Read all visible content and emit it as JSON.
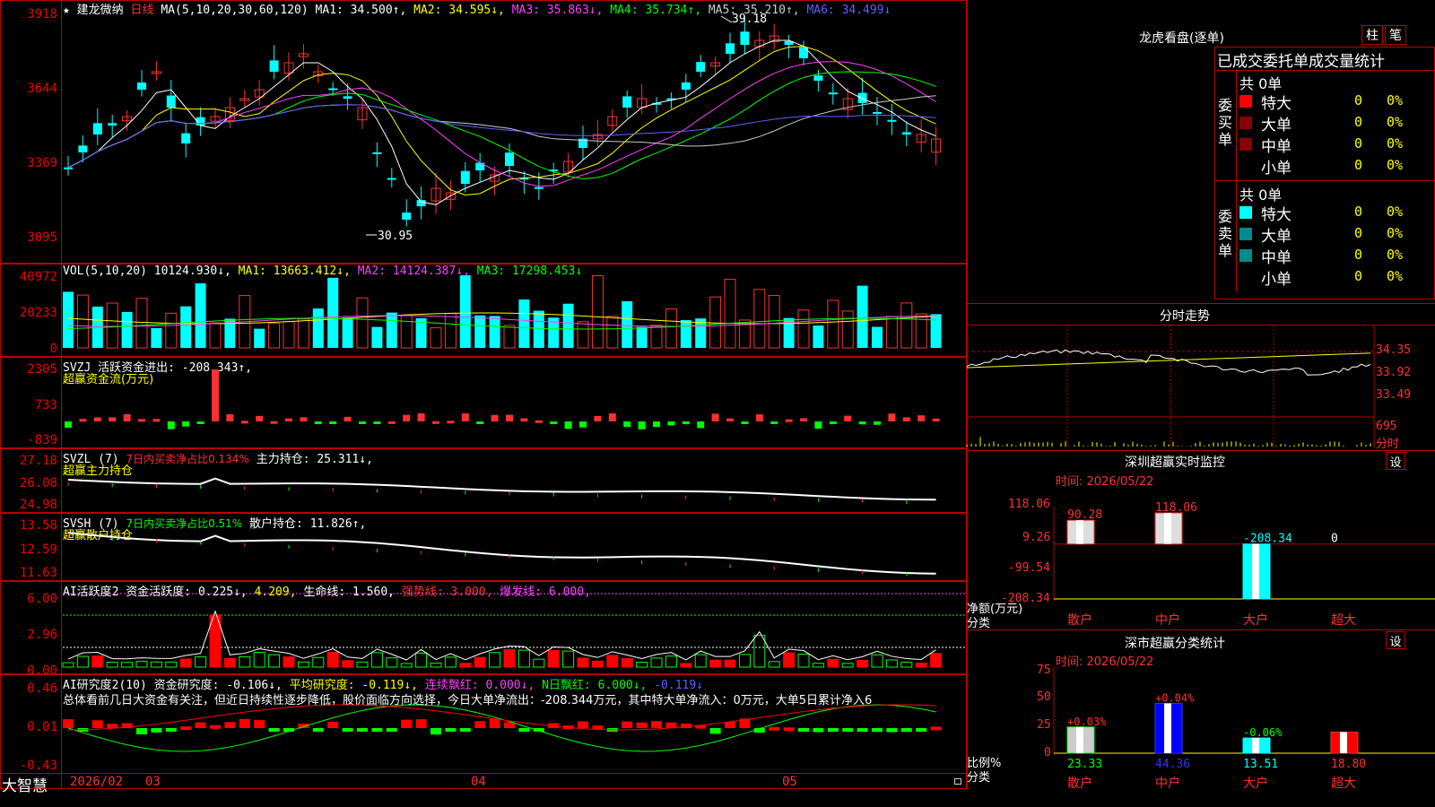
{
  "colors": {
    "up": "#ff3030",
    "down": "#00ffff",
    "border": "#b00000",
    "vol_down": "#00ffff"
  },
  "header": {
    "star": "★",
    "stock": "建龙微纳",
    "period": "日线",
    "ma_prefix": "MA(5,10,20,30,60,120)",
    "ma": [
      "MA1: 34.500↑,",
      "MA2: 34.595↓,",
      "MA3: 35.863↓,",
      "MA4: 35.734↑,",
      "MA5: 35.210↑,",
      "MA6: 34.499↓"
    ]
  },
  "price_axis": [
    "3918",
    "3644",
    "3369",
    "3095"
  ],
  "price_high": "39.18",
  "price_low": "30.95",
  "vol": {
    "axis": [
      "40972",
      "20233",
      "0"
    ],
    "prefix": "VOL(5,10,20)",
    "value": "10124.930↓,",
    "ma1": "MA1: 13663.412↓,",
    "ma2": "MA2: 14124.387↓,",
    "ma3": "MA3: 17298.453↓"
  },
  "svzj": {
    "axis": [
      "2305",
      "733",
      "-839"
    ],
    "title": "SVZJ  活跃资金进出: -208.343↑,",
    "sub": "超赢资金流(万元)"
  },
  "svzl": {
    "axis": [
      "27.18",
      "26.08",
      "24.98"
    ],
    "prefix": "SVZL (7)",
    "red": "7日内买卖净占比0.134%",
    "white": "主力持仓: 25.311↓,",
    "sub": "超赢主力持仓"
  },
  "svsh": {
    "axis": [
      "13.58",
      "12.59",
      "11.63"
    ],
    "prefix": "SVSH (7)",
    "grn": "7日内买卖净占比0.51%",
    "white": "散户持仓: 11.826↑,",
    "sub": "超赢散户持仓"
  },
  "ai2": {
    "axis": [
      "6.00",
      "2.96",
      "0.00"
    ],
    "a": "AI活跃度2 资金活跃度: 0.225↓,",
    "b": "4.209,",
    "c": "生命线: 1.560,",
    "d": "强势线: 3.000,",
    "e": "爆发线: 6.000,"
  },
  "ai_research": {
    "axis": [
      "0.46",
      "0.01",
      "-0.43"
    ],
    "a": "AI研究度2(10) 资金研究度: -0.106↓,",
    "b": "平均研究度: -0.119↓,",
    "c": "连续飘红: 0.000↓,",
    "d": "N日飘红: 6.000↓,",
    "e": "-0.119↓",
    "comment": "总体看前几日大资金有关注，但近日持续性逐步降低，股价面临方向选择，今日大单净流出：-208.344万元，其中特大单净流入：0万元，大单5日累计净入6"
  },
  "xaxis": {
    "brand": "大智慧",
    "labels": [
      "2026/02",
      "03",
      "04",
      "05"
    ]
  },
  "right": {
    "title": "龙虎看盘(逐单)",
    "btn1": "柱",
    "btn2": "笔",
    "table_title": "已成交委托单成交量统计",
    "buy": {
      "side": "委买单",
      "count": "共 0单",
      "rows": [
        {
          "name": "特大",
          "val": "0",
          "pct": "0%"
        },
        {
          "name": "大单",
          "val": "0",
          "pct": "0%"
        },
        {
          "name": "中单",
          "val": "0",
          "pct": "0%"
        },
        {
          "name": "小单",
          "val": "0",
          "pct": "0%"
        }
      ]
    },
    "sell": {
      "side": "委卖单",
      "count": "共 0单",
      "rows": [
        {
          "name": "特大",
          "val": "0",
          "pct": "0%"
        },
        {
          "name": "大单",
          "val": "0",
          "pct": "0%"
        },
        {
          "name": "中单",
          "val": "0",
          "pct": "0%"
        },
        {
          "name": "小单",
          "val": "0",
          "pct": "0%"
        }
      ]
    },
    "fenshi": {
      "title": "分时走势",
      "axis": [
        "34.35",
        "33.92",
        "33.49",
        "695",
        "分时"
      ]
    },
    "monitor": {
      "title": "深圳超赢实时监控",
      "btn": "设",
      "time": "时间: 2026/05/22",
      "axis": [
        "118.06",
        "9.26",
        "-99.54",
        "-208.34"
      ],
      "ylabel": "净额(万元)",
      "xlabel": "分类",
      "values": [
        90.28,
        118.06,
        -208.34,
        0
      ],
      "value_labels": [
        "90.28",
        "118.06",
        "-208.34",
        "0"
      ],
      "cats": [
        "散户",
        "中户",
        "大户",
        "超大"
      ]
    },
    "classify": {
      "title": "深市超赢分类统计",
      "btn": "设",
      "time": "时间: 2026/05/22",
      "axis": [
        "75",
        "50",
        "25",
        "0"
      ],
      "ylabel": "比例%",
      "xlabel": "分类",
      "values": [
        23.33,
        44.36,
        13.51,
        18.8
      ],
      "value_labels": [
        "23.33",
        "44.36",
        "13.51",
        "18.80"
      ],
      "changes": [
        "+0.03%",
        "+0.04%",
        "-0.06%",
        ""
      ],
      "cats": [
        "散户",
        "中户",
        "大户",
        "超大"
      ]
    }
  }
}
